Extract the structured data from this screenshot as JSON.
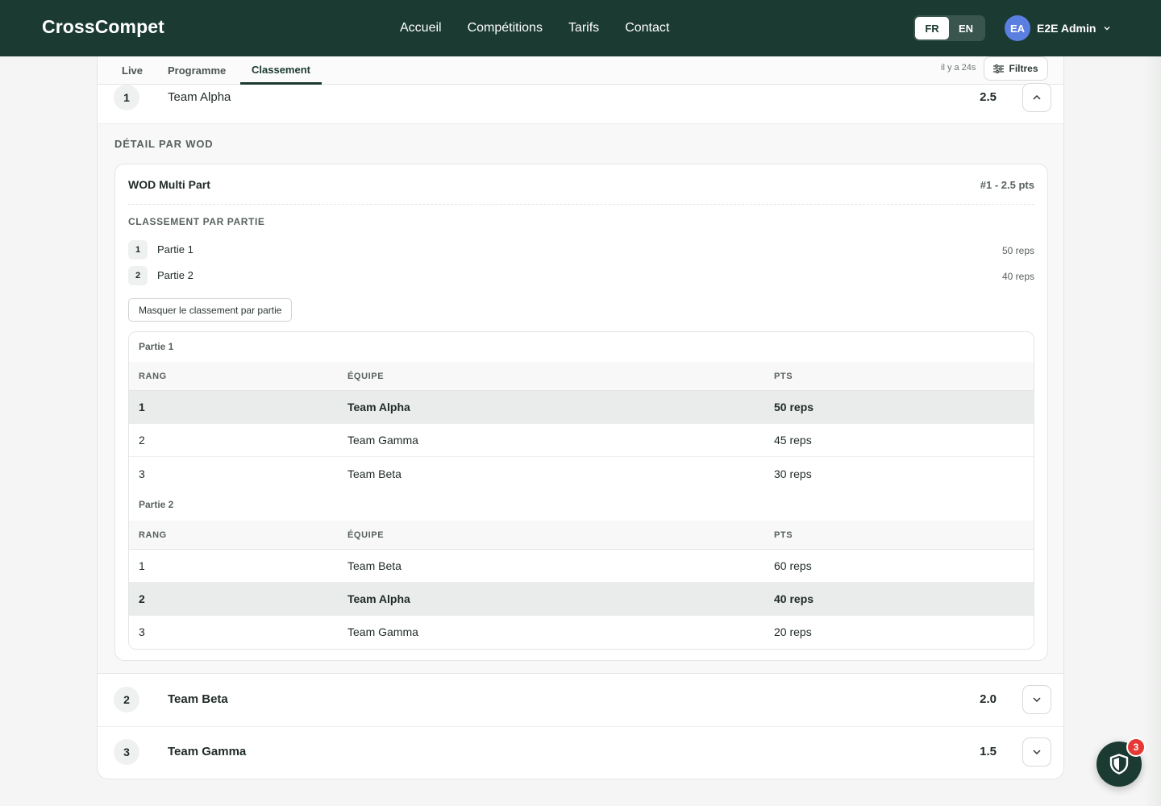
{
  "header": {
    "logo": "CrossCompet",
    "nav": [
      "Accueil",
      "Compétitions",
      "Tarifs",
      "Contact"
    ],
    "lang": {
      "fr": "FR",
      "en": "EN",
      "active": "FR"
    },
    "user": {
      "initials": "EA",
      "name": "E2E Admin"
    }
  },
  "tabs": {
    "live": "Live",
    "programme": "Programme",
    "classement": "Classement",
    "active": "Classement"
  },
  "toolbar": {
    "updated": "il y a 24s",
    "filters": "Filtres"
  },
  "teams": [
    {
      "rank": "1",
      "name": "Team Alpha",
      "score": "2.5",
      "expanded": true
    },
    {
      "rank": "2",
      "name": "Team Beta",
      "score": "2.0",
      "expanded": false
    },
    {
      "rank": "3",
      "name": "Team Gamma",
      "score": "1.5",
      "expanded": false
    }
  ],
  "detail": {
    "title": "DÉTAIL PAR WOD",
    "wod": {
      "name": "WOD Multi Part",
      "rank": "#1 - 2.5 pts",
      "parts_title": "CLASSEMENT PAR PARTIE",
      "parts": [
        {
          "num": "1",
          "label": "Partie 1",
          "value": "50 reps"
        },
        {
          "num": "2",
          "label": "Partie 2",
          "value": "40 reps"
        }
      ],
      "hide_button": "Masquer le classement par partie",
      "columns": {
        "rank": "RANG",
        "team": "ÉQUIPE",
        "pts": "PTS"
      },
      "tables": [
        {
          "caption": "Partie 1",
          "rows": [
            {
              "rank": "1",
              "team": "Team Alpha",
              "pts": "50 reps",
              "highlight": true
            },
            {
              "rank": "2",
              "team": "Team Gamma",
              "pts": "45 reps",
              "highlight": false
            },
            {
              "rank": "3",
              "team": "Team Beta",
              "pts": "30 reps",
              "highlight": false
            }
          ]
        },
        {
          "caption": "Partie 2",
          "rows": [
            {
              "rank": "1",
              "team": "Team Beta",
              "pts": "60 reps",
              "highlight": false
            },
            {
              "rank": "2",
              "team": "Team Alpha",
              "pts": "40 reps",
              "highlight": true
            },
            {
              "rank": "3",
              "team": "Team Gamma",
              "pts": "20 reps",
              "highlight": false
            }
          ]
        }
      ]
    }
  },
  "fab": {
    "icon": "shield-icon",
    "badge": "3"
  },
  "colors": {
    "primary": "#1b3a32",
    "highlight_row": "#e9ecea",
    "badge": "#e53935",
    "avatar": "#5b7fe0"
  }
}
